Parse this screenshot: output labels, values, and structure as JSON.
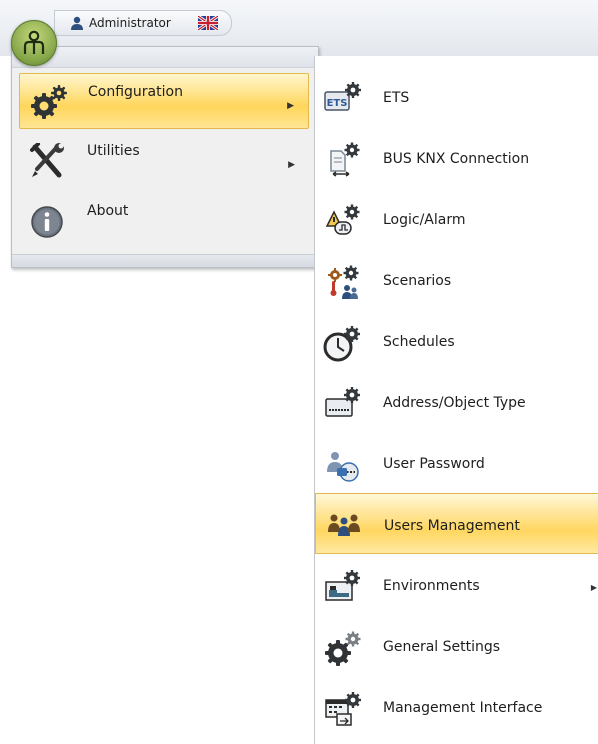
{
  "topbar": {
    "user_name": "Administrator",
    "user_icon": "user-icon",
    "flag_icon": "uk-flag-icon",
    "app_button_icon": "app-menu-icon"
  },
  "main_menu": {
    "items": [
      {
        "label": "Configuration",
        "icon": "gears-icon",
        "has_submenu": true,
        "highlighted": true
      },
      {
        "label": "Utilities",
        "icon": "tools-icon",
        "has_submenu": true,
        "highlighted": false
      },
      {
        "label": "About",
        "icon": "info-icon",
        "has_submenu": false,
        "highlighted": false
      }
    ]
  },
  "submenu": {
    "items": [
      {
        "label": "ETS",
        "icon": "ets-icon"
      },
      {
        "label": "BUS KNX Connection",
        "icon": "bus-connection-icon"
      },
      {
        "label": "Logic/Alarm",
        "icon": "logic-alarm-icon"
      },
      {
        "label": "Scenarios",
        "icon": "scenarios-icon"
      },
      {
        "label": "Schedules",
        "icon": "schedules-icon"
      },
      {
        "label": "Address/Object Type",
        "icon": "address-object-icon"
      },
      {
        "label": "User Password",
        "icon": "user-password-icon"
      },
      {
        "label": "Users Management",
        "icon": "users-management-icon",
        "highlighted": true
      },
      {
        "label": "Environments",
        "icon": "environments-icon",
        "has_submenu": true
      },
      {
        "label": "General Settings",
        "icon": "general-settings-icon"
      },
      {
        "label": "Management Interface",
        "icon": "management-interface-icon"
      }
    ]
  },
  "colors": {
    "highlight_light": "#fff6cf",
    "highlight_dark": "#ffd65c",
    "icon_blue": "#3a6fb0",
    "gear_dark": "#2f3336"
  }
}
